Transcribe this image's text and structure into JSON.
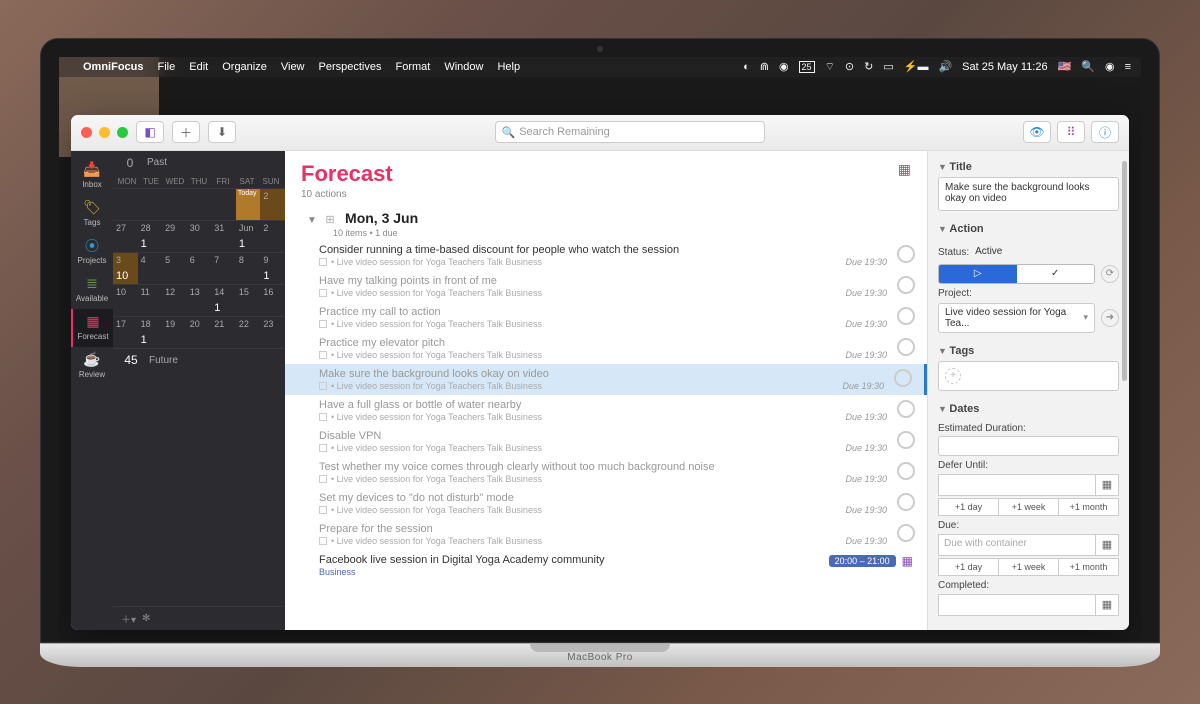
{
  "menubar": {
    "app": "OmniFocus",
    "items": [
      "File",
      "Edit",
      "Organize",
      "View",
      "Perspectives",
      "Format",
      "Window",
      "Help"
    ],
    "clock": "Sat 25 May  11:26",
    "battery_icon_text": "⚡"
  },
  "toolbar": {
    "search_placeholder": "Search Remaining"
  },
  "perspectives": [
    {
      "id": "inbox",
      "label": "Inbox",
      "icon": "📥",
      "color": "#6a5acd"
    },
    {
      "id": "tags",
      "label": "Tags",
      "icon": "🏷",
      "color": "#d8b13a"
    },
    {
      "id": "projects",
      "label": "Projects",
      "icon": "⦿",
      "color": "#2a9ad8"
    },
    {
      "id": "available",
      "label": "Available",
      "icon": "≣",
      "color": "#6a9a4a"
    },
    {
      "id": "forecast",
      "label": "Forecast",
      "icon": "▦",
      "color": "#ec2f64",
      "active": true
    },
    {
      "id": "review",
      "label": "Review",
      "icon": "☕",
      "color": "#c97a4a"
    }
  ],
  "calendar": {
    "past": {
      "count": "0",
      "label": "Past"
    },
    "days": [
      "MON",
      "TUE",
      "WED",
      "THU",
      "FRI",
      "SAT",
      "SUN"
    ],
    "rows": [
      [
        {
          "n": ""
        },
        {
          "n": ""
        },
        {
          "n": ""
        },
        {
          "n": ""
        },
        {
          "n": ""
        },
        {
          "n": "",
          "today": true,
          "c": ""
        },
        {
          "n": "2",
          "hl": true,
          "c": ""
        }
      ],
      [
        {
          "n": "27"
        },
        {
          "n": "28",
          "c": "1"
        },
        {
          "n": "29"
        },
        {
          "n": "30"
        },
        {
          "n": "31"
        },
        {
          "n": "Jun",
          "c": "1"
        },
        {
          "n": "2"
        }
      ],
      [
        {
          "n": "3",
          "c": "10",
          "hl": true
        },
        {
          "n": "4"
        },
        {
          "n": "5"
        },
        {
          "n": "6"
        },
        {
          "n": "7"
        },
        {
          "n": "8"
        },
        {
          "n": "9",
          "c": "1"
        }
      ],
      [
        {
          "n": "10"
        },
        {
          "n": "11"
        },
        {
          "n": "12"
        },
        {
          "n": "13"
        },
        {
          "n": "14",
          "c": "1"
        },
        {
          "n": "15"
        },
        {
          "n": "16"
        }
      ],
      [
        {
          "n": "17"
        },
        {
          "n": "18",
          "c": "1"
        },
        {
          "n": "19"
        },
        {
          "n": "20"
        },
        {
          "n": "21"
        },
        {
          "n": "22"
        },
        {
          "n": "23"
        }
      ]
    ],
    "future": {
      "count": "45",
      "label": "Future"
    }
  },
  "forecast": {
    "title": "Forecast",
    "subtitle": "10 actions",
    "group_title": "Mon, 3 Jun",
    "group_sub": "10 items • 1 due",
    "project": "Live video session for Yoga Teachers Talk Business",
    "due": "Due 19:30",
    "tasks": [
      {
        "t": "Consider running a time-based discount for people who watch the session",
        "dim": false
      },
      {
        "t": "Have my talking points in front of me",
        "dim": true
      },
      {
        "t": "Practice my call to action",
        "dim": true
      },
      {
        "t": "Practice my elevator pitch",
        "dim": true
      },
      {
        "t": "Make sure the background looks okay on video",
        "dim": true,
        "selected": true
      },
      {
        "t": "Have a full glass or bottle of water nearby",
        "dim": true
      },
      {
        "t": "Disable VPN",
        "dim": true
      },
      {
        "t": "Test whether my voice comes through clearly without too much background noise",
        "dim": true
      },
      {
        "t": "Set my devices to \"do not disturb\" mode",
        "dim": true
      },
      {
        "t": "Prepare for the session",
        "dim": true
      }
    ],
    "calendar_event": {
      "t": "Facebook live session in Digital Yoga Academy community",
      "calendar": "Business",
      "time": "20:00 – 21:00"
    }
  },
  "inspector": {
    "title_section": "Title",
    "title_value": "Make sure the background looks okay on video",
    "action_section": "Action",
    "status_label": "Status:",
    "status_value": "Active",
    "project_label": "Project:",
    "project_value": "Live video session for Yoga Tea...",
    "tags_section": "Tags",
    "dates_section": "Dates",
    "est_label": "Estimated Duration:",
    "defer_label": "Defer Until:",
    "due_label": "Due:",
    "due_placeholder": "Due with container",
    "completed_label": "Completed:",
    "quick": [
      "+1 day",
      "+1 week",
      "+1 month"
    ]
  },
  "laptop_label": "MacBook Pro"
}
